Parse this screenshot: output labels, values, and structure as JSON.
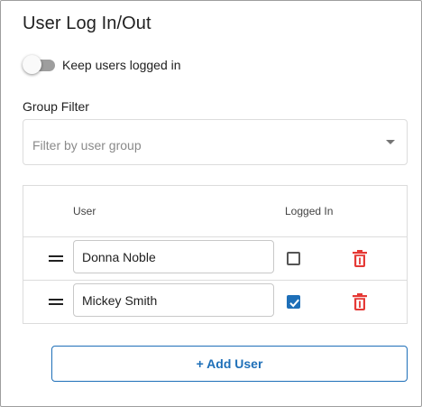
{
  "panel": {
    "title": "User Log In/Out",
    "keep_logged_in": {
      "label": "Keep users logged in",
      "enabled": false
    }
  },
  "group_filter": {
    "label": "Group Filter",
    "placeholder": "Filter by user group"
  },
  "table": {
    "columns": [
      "User",
      "Logged In"
    ],
    "rows": [
      {
        "name": "Donna Noble",
        "logged_in": false
      },
      {
        "name": "Mickey Smith",
        "logged_in": true
      }
    ]
  },
  "add_user_label": "+ Add User",
  "colors": {
    "accent": "#1e6fb8",
    "delete": "#e53935",
    "border": "#dcdcdc"
  },
  "icons": [
    "drag-handle-icon",
    "checkbox-icon",
    "trash-icon",
    "dropdown-caret-icon"
  ]
}
